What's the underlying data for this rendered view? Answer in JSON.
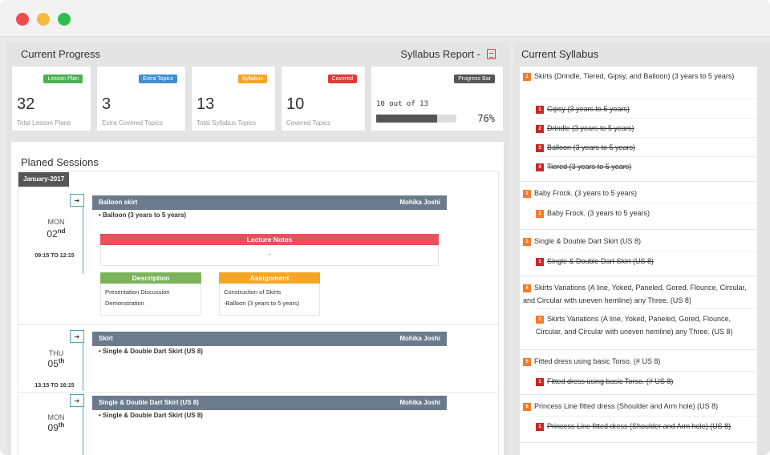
{
  "left": {
    "title": "Current Progress",
    "report_label": "Syllabus Report -"
  },
  "cards": [
    {
      "badge": "Lesson Plan",
      "badge_color": "#4caf50",
      "number": "32",
      "label": "Total Lesson Plans"
    },
    {
      "badge": "Extra Topics",
      "badge_color": "#3f8fd2",
      "number": "3",
      "label": "Extra Covered Topics"
    },
    {
      "badge": "Syllabus",
      "badge_color": "#f5a623",
      "number": "13",
      "label": "Total Syllabus Topics"
    },
    {
      "badge": "Covered",
      "badge_color": "#e53935",
      "number": "10",
      "label": "Covered Topics"
    }
  ],
  "progress": {
    "badge": "Progress Bar",
    "badge_color": "#555555",
    "text": "10 out of 13",
    "percent_label": "76%",
    "fraction": 0.76
  },
  "sessions": {
    "title": "Planed Sessions",
    "month": "January-2017",
    "items": [
      {
        "day": "MON",
        "date": "02",
        "suffix": "nd",
        "time": "09:15 TO 12:15",
        "topic": "Balloon skirt",
        "teacher": "Mohika Joshi",
        "bullet": "Balloon (3 years to 5 years)",
        "notes_title": "Lecture Notes",
        "notes_body": "-",
        "description_title": "Description",
        "description_lines": [
          "Presentation Discussion",
          "Demonstration"
        ],
        "assignment_title": "Assignment",
        "assignment_lines": [
          "Construction of Skirts",
          "-Balloon (3 years to 5 years)"
        ]
      },
      {
        "day": "THU",
        "date": "05",
        "suffix": "th",
        "time": "13:15 TO 16:15",
        "topic": "Skirt",
        "teacher": "Mohika Joshi",
        "bullet": "Single & Double Dart Skirt (US 8)"
      },
      {
        "day": "MON",
        "date": "09",
        "suffix": "th",
        "topic": "Single & Double Dart Skirt (US 8)",
        "teacher": "Mohika Joshi",
        "bullet": "Single & Double Dart Skirt (US 8)"
      }
    ]
  },
  "syllabus": {
    "title": "Current Syllabus",
    "groups": [
      {
        "n": "1",
        "title": "Skirts (Drindle, Tiered, Gipsy, and Balloon) (3 years to 5 years)",
        "children": [
          {
            "n": "1",
            "text": "Gipsy (3 years to 5 years)",
            "done": true
          },
          {
            "n": "2",
            "text": "Drindle (3 years to 5 years)",
            "done": true
          },
          {
            "n": "3",
            "text": "Balloon (3 years to 5 years)",
            "done": true
          },
          {
            "n": "4",
            "text": "Tiered (3 years to 5 years)",
            "done": true
          }
        ]
      },
      {
        "n": "2",
        "title": "Baby Frock. (3 years to 5 years)",
        "children": [
          {
            "n": "1",
            "text": "Baby Frock. (3 years to 5 years)",
            "done": false
          }
        ]
      },
      {
        "n": "3",
        "title": "Single & Double Dart Skirt (US 8)",
        "children": [
          {
            "n": "1",
            "text": "Single & Double Dart Skirt (US 8)",
            "done": true
          }
        ]
      },
      {
        "n": "4",
        "title": "Skirts Variations (A line, Yoked, Paneled, Gored, Flounce, Circular, and Circular with uneven hemline) any Three. (US 8)",
        "children": [
          {
            "n": "1",
            "text": "Skirts Variations (A line, Yoked, Paneled, Gored, Flounce, Circular, and Circular with uneven hemline) any Three. (US 8)",
            "done": false
          }
        ]
      },
      {
        "n": "5",
        "title": "Fitted dress using basic Torso. (# US 8)",
        "children": [
          {
            "n": "1",
            "text": "Fitted dress using basic Torso. (# US 8)",
            "done": true
          }
        ]
      },
      {
        "n": "6",
        "title": "Princess Line fitted dress (Shoulder and Arm hole) (US 8)",
        "children": [
          {
            "n": "1",
            "text": "Princess Line fitted dress (Shoulder and Arm hole) (US 8)",
            "done": true
          }
        ]
      }
    ]
  }
}
